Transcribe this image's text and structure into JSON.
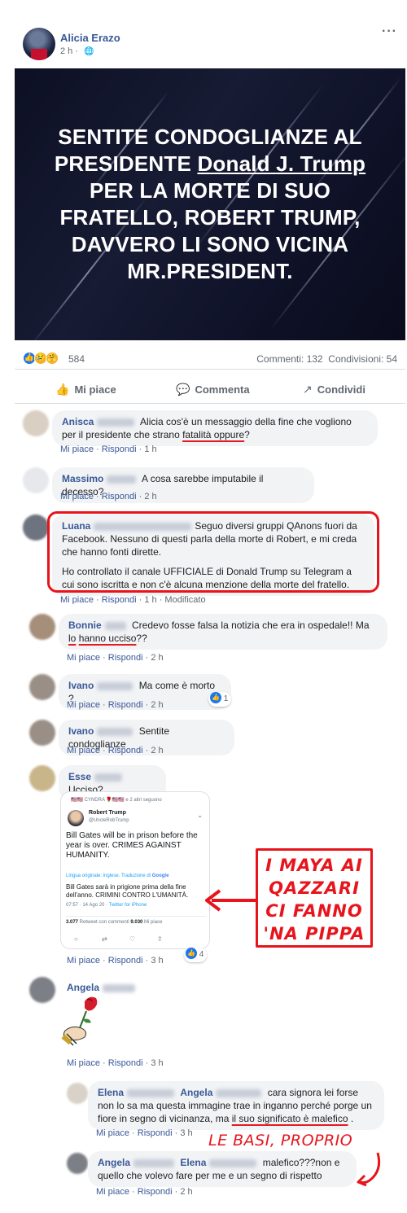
{
  "post": {
    "author": "Alicia Erazo",
    "time": "2 h ·",
    "more": "···",
    "image_text": {
      "line1": "SENTITE CONDOGLIANZE AL",
      "line2a": "PRESIDENTE ",
      "line2b": "Donald J. Trump",
      "line3": "PER LA MORTE DI SUO",
      "line4": "FRATELLO, ROBERT TRUMP,",
      "line5": "DAVVERO LI SONO VICINA",
      "line6": "MR.PRESIDENT."
    },
    "reaction_count": "584",
    "comments_count": "Commenti: 132",
    "shares_count": "Condivisioni: 54",
    "actions": {
      "like": "Mi piace",
      "comment": "Commenta",
      "share": "Condividi"
    }
  },
  "comments_panel1": [
    {
      "name": "Anisca",
      "text_a": "Alicia cos'è un messaggio della fine che vogliono per il presidente che strano ",
      "text_ul": "fatalità oppure",
      "text_b": "?",
      "like": "Mi piace",
      "reply": "Rispondi",
      "time": "1 h"
    },
    {
      "name": "Massimo",
      "text": "A cosa sarebbe imputabile il decesso?",
      "like": "Mi piace",
      "reply": "Rispondi",
      "time": "2 h"
    },
    {
      "name": "Luana",
      "text1": "Seguo diversi gruppi QAnons fuori da Facebook. Nessuno di questi parla della morte di Robert, e mi creda che hanno fonti dirette.",
      "text2": "Ho controllato il canale UFFICIALE di Donald Trump su Telegram a cui sono iscritta e non c'è alcuna menzione della morte del fratello.",
      "like": "Mi piace",
      "reply": "Rispondi",
      "time": "1 h",
      "edited": "Modificato"
    }
  ],
  "comments_panel2": [
    {
      "name": "Bonnie",
      "text_a": "Credevo fosse falsa la notizia che era in ospedale!! Ma ",
      "text_ul1": "lo",
      "text_ul2": "hanno ucciso",
      "text_b": "??",
      "like": "Mi piace",
      "reply": "Rispondi",
      "time": "2 h"
    },
    {
      "name": "Ivano",
      "text": "Ma come è morto ?",
      "like": "Mi piace",
      "reply": "Rispondi",
      "time": "2 h",
      "likes": "1"
    },
    {
      "name": "Ivano",
      "text": "Sentite condoglianze",
      "like": "Mi piace",
      "reply": "Rispondi",
      "time": "2 h"
    },
    {
      "name": "Esse",
      "text_ul": "Ucciso",
      "text_b": "?",
      "like": "Mi piace",
      "reply": "Rispondi",
      "time": "3 h",
      "likes": "4"
    },
    {
      "name": "Angela",
      "like": "Mi piace",
      "reply": "Rispondi",
      "time": "3 h"
    },
    {
      "name": "Elena",
      "tag": "Angela",
      "text_a": "cara signora lei forse non lo sa ma questa immagine trae in inganno perché porge un fiore in segno di vicinanza, ma ",
      "text_ul": "il suo significato è malefico",
      "text_b": " .",
      "like": "Mi piace",
      "reply": "Rispondi",
      "time": "3 h"
    },
    {
      "name": "Angela",
      "tag": "Elena",
      "text": "malefico???non e quello che volevo fare per me e un segno di rispetto",
      "like": "Mi piace",
      "reply": "Rispondi",
      "time": "2 h"
    }
  ],
  "tweet": {
    "top": "🇺🇸🇺🇸 CYNDRA 🌹🇺🇸🇺🇸 e 2 altri seguono",
    "name": "Robert Trump",
    "handle": "@UncleRobTrump",
    "text": "Bill Gates will be in prison before the year is over. CRIMES AGAINST HUMANITY.",
    "lang_label": "Lingua originale: inglese. Traduzione di ",
    "google": "Google",
    "translation": "Bill Gates sarà in prigione prima della fine dell'anno. CRIMINI CONTRO L'UMANITÀ.",
    "time": "07:57 · 14 Ago 20 · ",
    "via": "Twitter for iPhone",
    "retweets_num": "3.077",
    "retweets_label": " Retweet con commenti ",
    "likes_num": "9.030",
    "likes_label": " Mi piace"
  },
  "annotations": {
    "maya": [
      "I MAYA AI",
      "QAZZARI",
      "CI FANNO",
      "'NA PIPPA"
    ],
    "basi": "LE BASI, PROPRIO"
  },
  "colors": {
    "link": "#385898",
    "annotation_red": "#e8141c",
    "bubble": "#f2f3f5"
  }
}
